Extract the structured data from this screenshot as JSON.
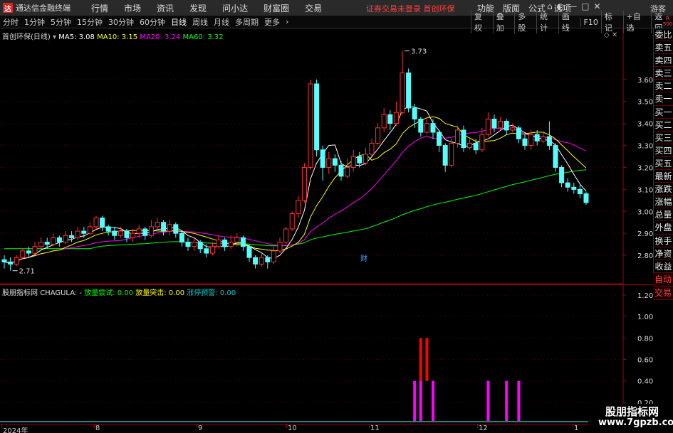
{
  "titlebar": {
    "app_name": "通达信金融终端",
    "menu": [
      "行情",
      "市场",
      "资讯",
      "发现",
      "问小达",
      "财富圈",
      "交易"
    ],
    "notice": "证券交易未登录  首创环保",
    "right_menu": [
      "功能",
      "版面",
      "公式",
      "选项"
    ],
    "guest": "游客"
  },
  "periodbar": {
    "periods": [
      "分时",
      "1分钟",
      "5分钟",
      "15分钟",
      "30分钟",
      "60分钟",
      "日线",
      "周线",
      "月线",
      "多周期",
      "更多"
    ],
    "active": "日线",
    "right_items": [
      "复权",
      "叠加",
      "多股",
      "统计",
      "画线",
      "F10",
      "标记",
      "+自选",
      "返回"
    ]
  },
  "badge": "R\n500",
  "side_items": [
    "委比",
    "卖五",
    "卖四",
    "卖三",
    "卖二",
    "卖一",
    "买一",
    "买二",
    "买三",
    "买四",
    "买五",
    "最新",
    "涨跌",
    "涨幅",
    "总量",
    "外盘",
    "换手",
    "净资",
    "收益"
  ],
  "side_trade": [
    "自动",
    "交易"
  ],
  "main_info": {
    "stock": "首创环保(日线)",
    "ma5": "MA5: 3.08",
    "ma10": "MA10: 3.15",
    "ma20": "MA20: 3.24",
    "ma60": "MA60: 3.32"
  },
  "ind_info": {
    "name": "股朋指标网",
    "chagula": "CHAGULA: -",
    "l1": "放量尝试: 0.00",
    "l2": "放量突击: 0.00",
    "l3": "涨停预警: 0.00"
  },
  "annotations": {
    "high": "3.73",
    "low": "2.71",
    "cai": "财"
  },
  "dates": [
    "2024年",
    "8",
    "9",
    "10",
    "11",
    "12",
    "1"
  ],
  "watermark": {
    "line1": "股朋指标网",
    "line2": "www.7gpzb.com"
  },
  "colors": {
    "up": "#ff3232",
    "down": "#54ffff",
    "ma5": "#ffffff",
    "ma10": "#ffff00",
    "ma20": "#ff00ff",
    "ma60": "#00ff00"
  },
  "chart_data": [
    {
      "type": "candlestick",
      "title": "首创环保(日线)",
      "ylim": [
        2.7,
        3.8
      ],
      "yticks": [
        2.8,
        2.9,
        3.0,
        3.1,
        3.2,
        3.3,
        3.4,
        3.5,
        3.6
      ],
      "candles": [
        [
          2.78,
          2.77,
          2.8,
          2.74
        ],
        [
          2.77,
          2.76,
          2.79,
          2.73
        ],
        [
          2.76,
          2.79,
          2.8,
          2.75
        ],
        [
          2.79,
          2.82,
          2.83,
          2.78
        ],
        [
          2.82,
          2.81,
          2.84,
          2.79
        ],
        [
          2.81,
          2.84,
          2.86,
          2.8
        ],
        [
          2.84,
          2.86,
          2.88,
          2.83
        ],
        [
          2.86,
          2.85,
          2.88,
          2.83
        ],
        [
          2.85,
          2.88,
          2.9,
          2.84
        ],
        [
          2.88,
          2.86,
          2.89,
          2.84
        ],
        [
          2.86,
          2.89,
          2.91,
          2.85
        ],
        [
          2.89,
          2.88,
          2.91,
          2.86
        ],
        [
          2.88,
          2.91,
          2.93,
          2.87
        ],
        [
          2.91,
          2.9,
          2.93,
          2.88
        ],
        [
          2.9,
          2.93,
          2.95,
          2.89
        ],
        [
          2.93,
          2.97,
          2.98,
          2.92
        ],
        [
          2.97,
          2.93,
          2.98,
          2.91
        ],
        [
          2.93,
          2.91,
          2.94,
          2.89
        ],
        [
          2.91,
          2.89,
          2.93,
          2.87
        ],
        [
          2.89,
          2.91,
          2.93,
          2.88
        ],
        [
          2.91,
          2.88,
          2.92,
          2.86
        ],
        [
          2.88,
          2.9,
          2.92,
          2.86
        ],
        [
          2.9,
          2.92,
          2.94,
          2.88
        ],
        [
          2.92,
          2.89,
          2.93,
          2.87
        ],
        [
          2.89,
          2.93,
          2.96,
          2.88
        ],
        [
          2.93,
          2.95,
          2.97,
          2.91
        ],
        [
          2.95,
          2.91,
          2.96,
          2.89
        ],
        [
          2.91,
          2.94,
          2.96,
          2.89
        ],
        [
          2.94,
          2.9,
          2.95,
          2.88
        ],
        [
          2.9,
          2.86,
          2.91,
          2.84
        ],
        [
          2.86,
          2.84,
          2.88,
          2.82
        ],
        [
          2.84,
          2.86,
          2.88,
          2.82
        ],
        [
          2.86,
          2.83,
          2.87,
          2.81
        ],
        [
          2.83,
          2.81,
          2.85,
          2.79
        ],
        [
          2.81,
          2.84,
          2.86,
          2.8
        ],
        [
          2.84,
          2.87,
          2.89,
          2.83
        ],
        [
          2.87,
          2.84,
          2.88,
          2.82
        ],
        [
          2.84,
          2.86,
          2.89,
          2.83
        ],
        [
          2.86,
          2.88,
          2.9,
          2.84
        ],
        [
          2.88,
          2.84,
          2.89,
          2.82
        ],
        [
          2.84,
          2.79,
          2.85,
          2.77
        ],
        [
          2.79,
          2.76,
          2.8,
          2.74
        ],
        [
          2.76,
          2.79,
          2.81,
          2.75
        ],
        [
          2.79,
          2.77,
          2.8,
          2.74
        ],
        [
          2.77,
          2.82,
          2.84,
          2.76
        ],
        [
          2.82,
          2.86,
          2.88,
          2.81
        ],
        [
          2.86,
          2.92,
          2.93,
          2.85
        ],
        [
          2.92,
          2.99,
          3.0,
          2.91
        ],
        [
          2.99,
          3.05,
          3.07,
          2.97
        ],
        [
          3.05,
          3.2,
          3.22,
          3.04
        ],
        [
          3.2,
          3.58,
          3.6,
          3.19
        ],
        [
          3.58,
          3.28,
          3.6,
          3.25
        ],
        [
          3.28,
          3.2,
          3.3,
          3.14
        ],
        [
          3.2,
          3.24,
          3.27,
          3.17
        ],
        [
          3.24,
          3.21,
          3.26,
          3.18
        ],
        [
          3.21,
          3.16,
          3.23,
          3.14
        ],
        [
          3.16,
          3.2,
          3.24,
          3.15
        ],
        [
          3.2,
          3.25,
          3.28,
          3.18
        ],
        [
          3.25,
          3.22,
          3.27,
          3.2
        ],
        [
          3.22,
          3.26,
          3.29,
          3.21
        ],
        [
          3.26,
          3.31,
          3.33,
          3.25
        ],
        [
          3.31,
          3.38,
          3.4,
          3.3
        ],
        [
          3.38,
          3.44,
          3.47,
          3.36
        ],
        [
          3.44,
          3.4,
          3.46,
          3.37
        ],
        [
          3.4,
          3.45,
          3.5,
          3.39
        ],
        [
          3.45,
          3.63,
          3.73,
          3.44
        ],
        [
          3.63,
          3.47,
          3.65,
          3.45
        ],
        [
          3.47,
          3.42,
          3.49,
          3.38
        ],
        [
          3.42,
          3.36,
          3.43,
          3.34
        ],
        [
          3.36,
          3.4,
          3.43,
          3.35
        ],
        [
          3.4,
          3.36,
          3.42,
          3.33
        ],
        [
          3.36,
          3.3,
          3.37,
          3.27
        ],
        [
          3.3,
          3.21,
          3.31,
          3.18
        ],
        [
          3.21,
          3.31,
          3.33,
          3.2
        ],
        [
          3.31,
          3.37,
          3.39,
          3.29
        ],
        [
          3.37,
          3.29,
          3.39,
          3.27
        ],
        [
          3.29,
          3.31,
          3.33,
          3.28
        ],
        [
          3.31,
          3.28,
          3.33,
          3.26
        ],
        [
          3.28,
          3.35,
          3.38,
          3.27
        ],
        [
          3.35,
          3.42,
          3.45,
          3.34
        ],
        [
          3.42,
          3.38,
          3.44,
          3.36
        ],
        [
          3.38,
          3.41,
          3.43,
          3.37
        ],
        [
          3.41,
          3.37,
          3.42,
          3.35
        ],
        [
          3.37,
          3.38,
          3.4,
          3.36
        ],
        [
          3.38,
          3.33,
          3.39,
          3.31
        ],
        [
          3.33,
          3.3,
          3.35,
          3.28
        ],
        [
          3.3,
          3.35,
          3.37,
          3.28
        ],
        [
          3.35,
          3.32,
          3.37,
          3.3
        ],
        [
          3.32,
          3.34,
          3.36,
          3.31
        ],
        [
          3.34,
          3.3,
          3.41,
          3.28
        ],
        [
          3.3,
          3.2,
          3.31,
          3.18
        ],
        [
          3.2,
          3.13,
          3.21,
          3.11
        ],
        [
          3.13,
          3.11,
          3.15,
          3.09
        ],
        [
          3.11,
          3.1,
          3.13,
          3.08
        ],
        [
          3.1,
          3.08,
          3.12,
          3.06
        ],
        [
          3.08,
          3.04,
          3.09,
          3.03
        ]
      ]
    },
    {
      "type": "bar",
      "title": "CHAGULA",
      "series": [
        {
          "name": "放量尝试",
          "values": {
            "67": 0.4,
            "68": 0.4,
            "70": 0.4,
            "79": 0.4,
            "82": 0.4,
            "84": 0.4
          }
        },
        {
          "name": "放量突击",
          "values": {
            "68": 0.8,
            "69": 0.8
          }
        }
      ],
      "ylim": [
        0,
        1.3
      ],
      "yticks": [
        0.2,
        0.4,
        0.6,
        0.8,
        1.0,
        1.2
      ]
    }
  ]
}
